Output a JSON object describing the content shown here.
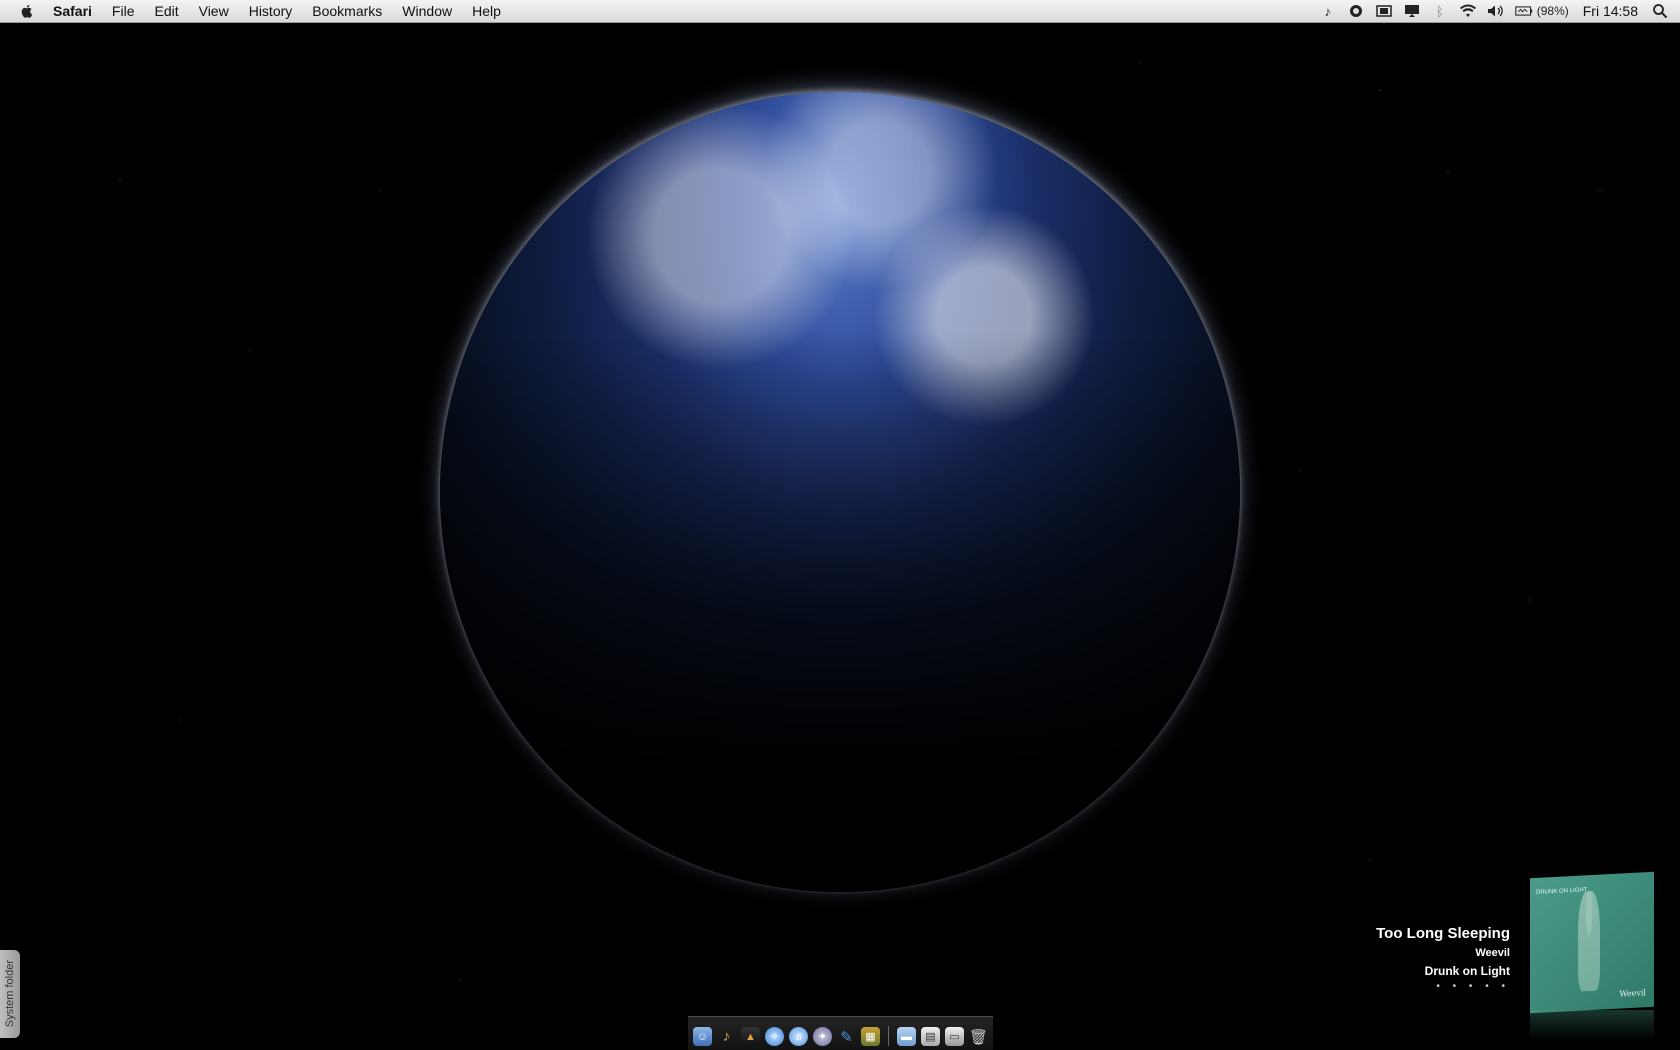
{
  "menubar": {
    "app_name": "Safari",
    "menus": [
      "File",
      "Edit",
      "View",
      "History",
      "Bookmarks",
      "Window",
      "Help"
    ],
    "battery": "(98%)",
    "clock": "Fri 14:58",
    "status_icons": [
      "sync-icon",
      "quicksilver-icon",
      "display-icon",
      "airplay-icon",
      "bluetooth-icon",
      "wifi-icon",
      "volume-icon",
      "battery-icon"
    ]
  },
  "now_playing": {
    "title": "Too Long Sleeping",
    "artist": "Weevil",
    "album": "Drunk on Light",
    "rating": "• • • • •",
    "album_art_text": "DRUNK ON LIGHT",
    "album_art_signature": "Weevil"
  },
  "system_folder": {
    "label": "System folder"
  },
  "dock": {
    "icons": [
      "finder-icon",
      "guitar-icon",
      "app-icon",
      "safari-icon",
      "itunes-icon",
      "safari-alt-icon",
      "pen-icon",
      "calculator-icon",
      "folder-icon",
      "preview-icon",
      "drive-icon",
      "trash-icon"
    ]
  },
  "colors": {
    "menubar": "#e6e6e6",
    "desktop": "#000000",
    "album_art": "#3d8c78"
  }
}
